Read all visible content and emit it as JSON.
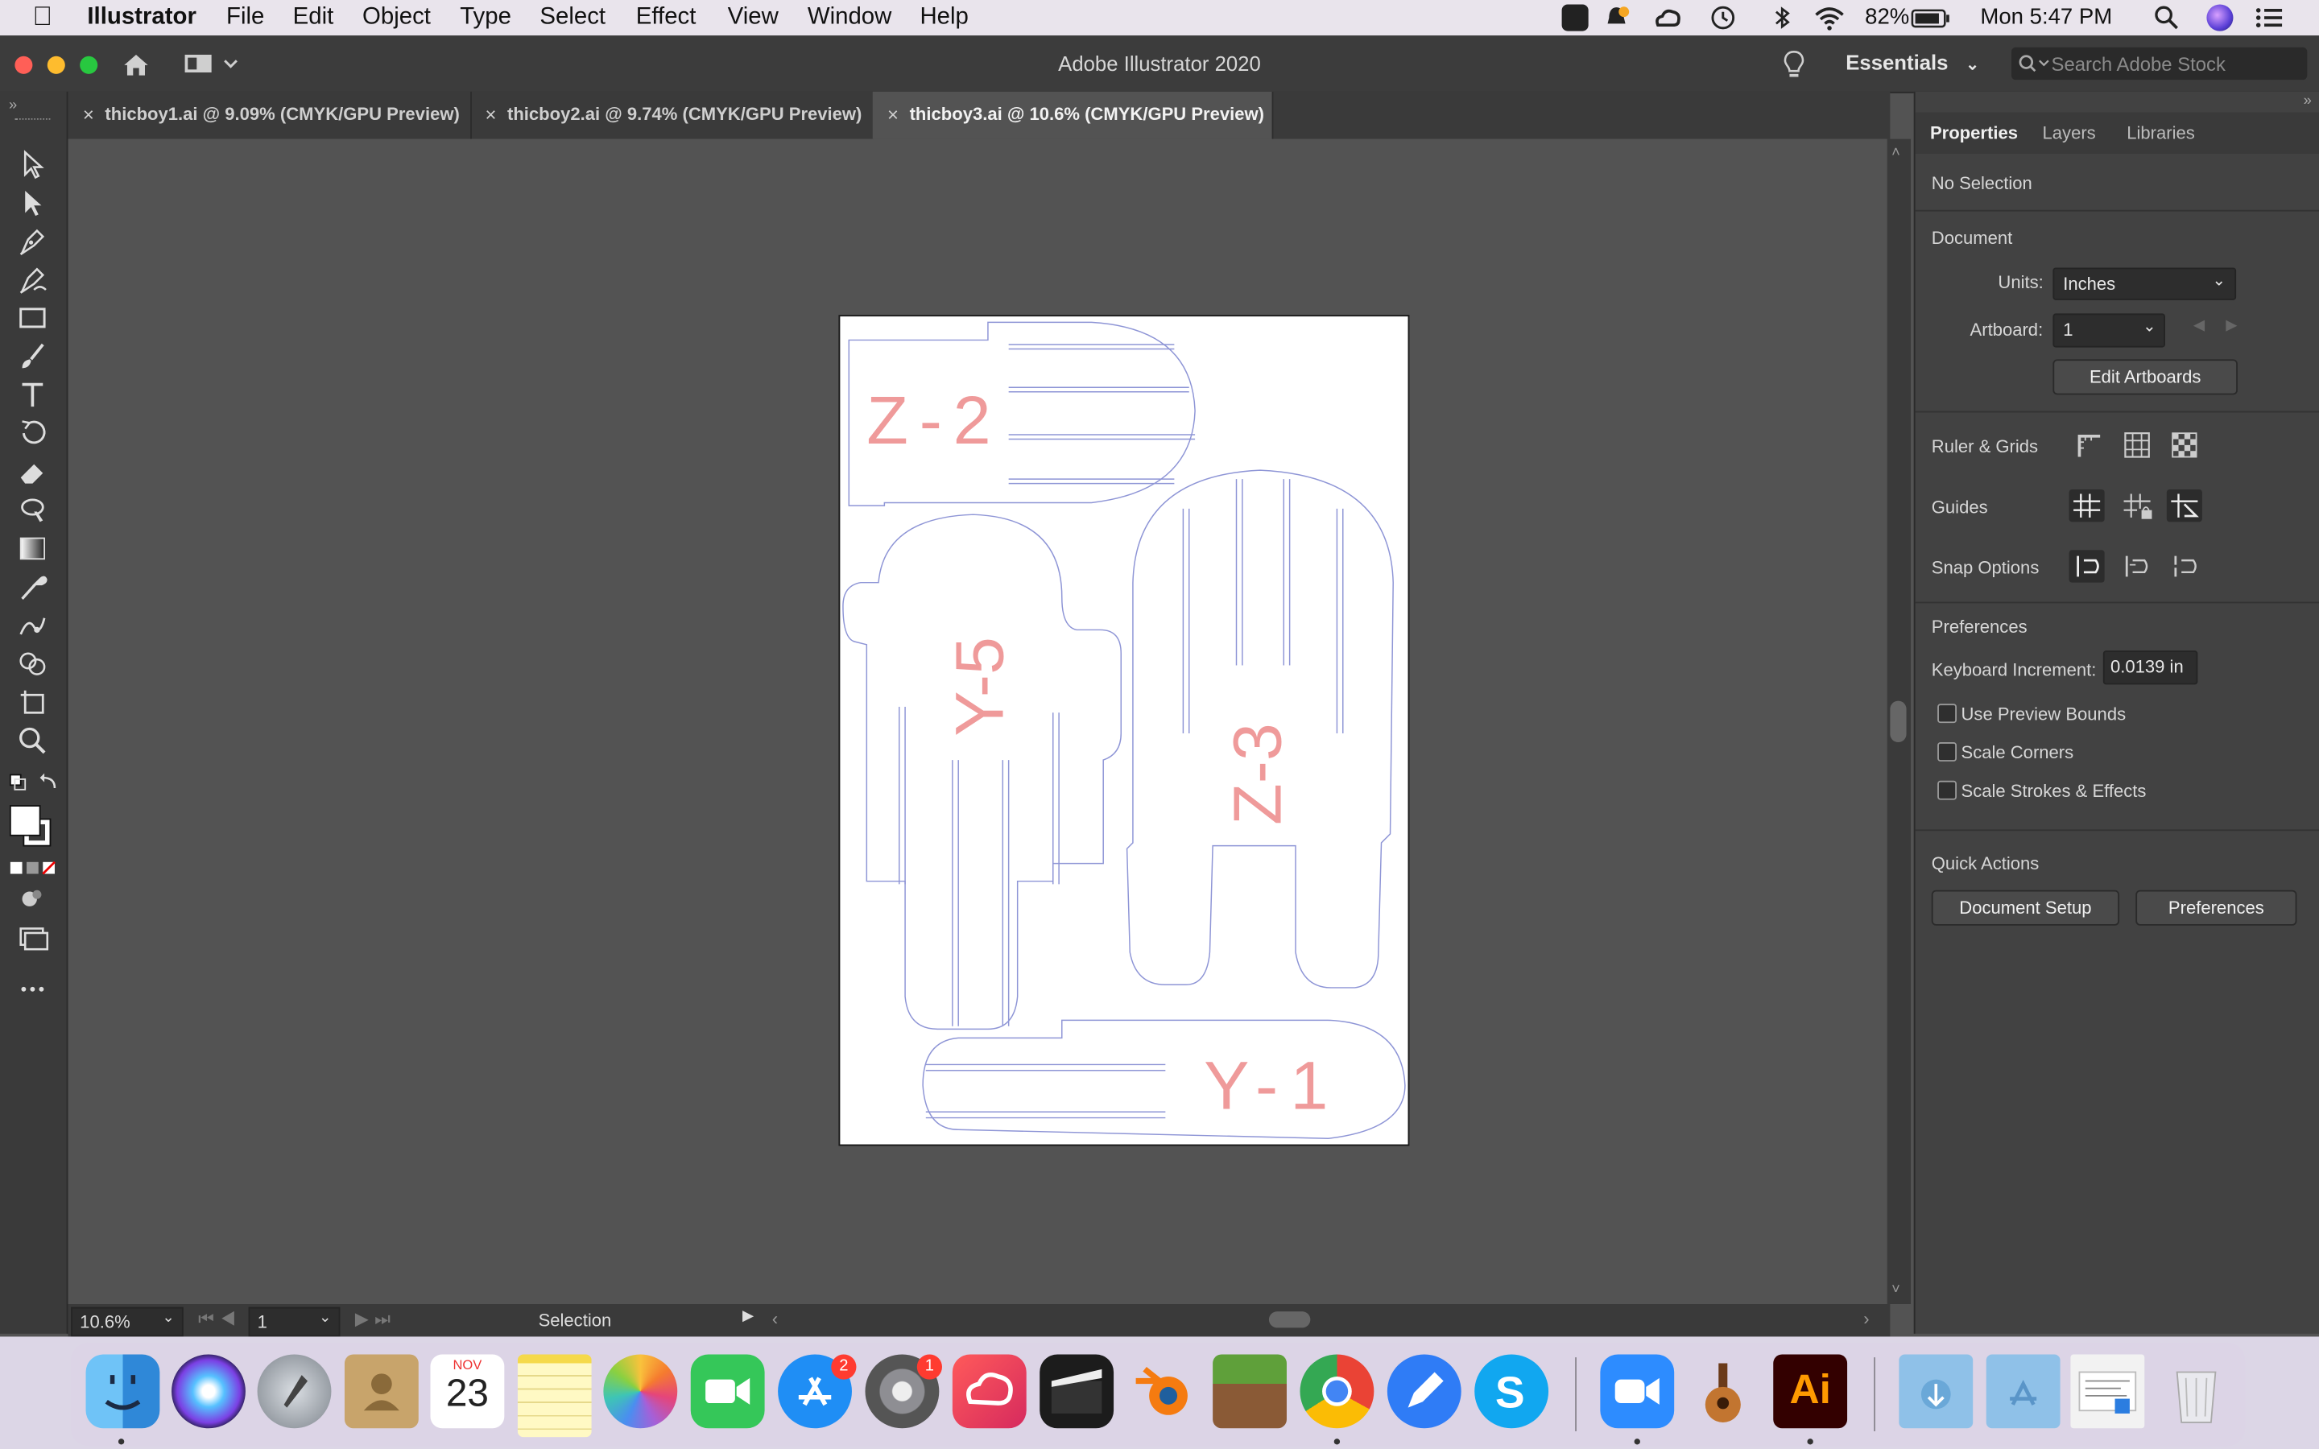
{
  "menubar": {
    "app": "Illustrator",
    "items": [
      "File",
      "Edit",
      "Object",
      "Type",
      "Select",
      "Effect",
      "View",
      "Window",
      "Help"
    ],
    "battery": "82%",
    "clock": "Mon 5:47 PM"
  },
  "window": {
    "title": "Adobe Illustrator 2020",
    "workspace": "Essentials",
    "search_placeholder": "Search Adobe Stock"
  },
  "tabs": [
    {
      "label": "thicboy1.ai @ 9.09% (CMYK/GPU Preview)"
    },
    {
      "label": "thicboy2.ai @ 9.74% (CMYK/GPU Preview)"
    },
    {
      "label": "thicboy3.ai @ 10.6% (CMYK/GPU Preview)"
    }
  ],
  "artboard": {
    "labels": [
      "Z-2",
      "Y-5",
      "Z-3",
      "Y-1"
    ]
  },
  "status": {
    "zoom": "10.6%",
    "artboard_num": "1",
    "tool": "Selection"
  },
  "panel": {
    "tabs": [
      "Properties",
      "Layers",
      "Libraries"
    ],
    "selection": "No Selection",
    "document_header": "Document",
    "units_label": "Units:",
    "units_value": "Inches",
    "artboard_label": "Artboard:",
    "artboard_value": "1",
    "edit_artboards": "Edit Artboards",
    "ruler_grids": "Ruler & Grids",
    "guides": "Guides",
    "snap_options": "Snap Options",
    "preferences_header": "Preferences",
    "keyboard_increment_label": "Keyboard Increment:",
    "keyboard_increment_value": "0.0139 in",
    "use_preview_bounds": "Use Preview Bounds",
    "scale_corners": "Scale Corners",
    "scale_strokes": "Scale Strokes & Effects",
    "quick_actions": "Quick Actions",
    "document_setup": "Document Setup",
    "preferences_button": "Preferences"
  },
  "dock": {
    "calendar_month": "NOV",
    "calendar_day": "23",
    "appstore_badge": "2",
    "settings_badge": "1",
    "illustrator_label": "Ai"
  },
  "colors": {
    "cut_line": "#8e95d6",
    "engrave_text": "#ef9a9a",
    "panel_bg": "#424242",
    "canvas_bg": "#535353"
  }
}
